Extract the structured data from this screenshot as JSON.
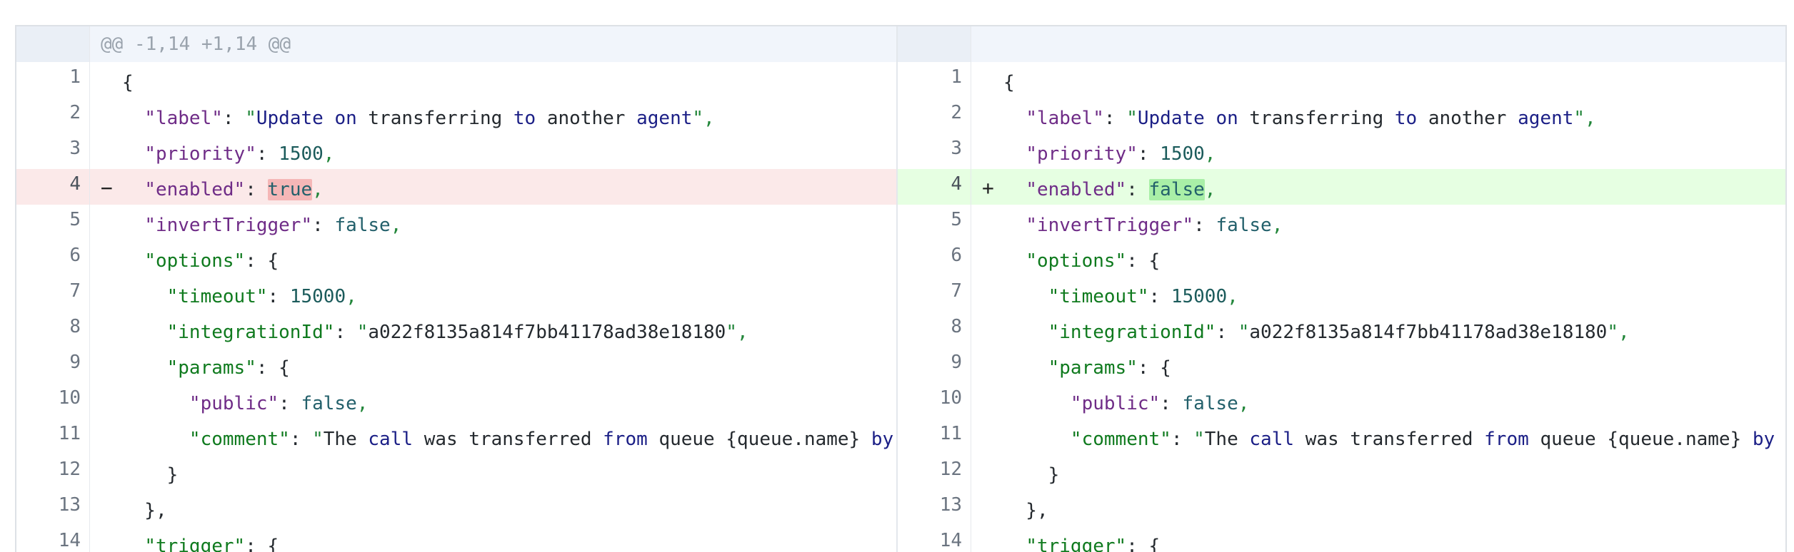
{
  "hunk_header": "@@ -1,14 +1,14 @@",
  "markers": {
    "removed": "−",
    "added": "+"
  },
  "left": {
    "lines": [
      {
        "n": "1",
        "t": "{"
      },
      {
        "n": "2",
        "pre": "  ",
        "k": "\"label\"",
        "sep": ": ",
        "v": "\"Update on transferring to another agent\"",
        "post": ","
      },
      {
        "n": "3",
        "pre": "  ",
        "k": "\"priority\"",
        "sep": ": ",
        "v": "1500",
        "post": ","
      },
      {
        "n": "4",
        "pre": "  ",
        "k": "\"enabled\"",
        "sep": ": ",
        "v": "true",
        "post": ",",
        "type": "del"
      },
      {
        "n": "5",
        "pre": "  ",
        "k": "\"invertTrigger\"",
        "sep": ": ",
        "v": "false",
        "post": ","
      },
      {
        "n": "6",
        "pre": "  ",
        "k": "\"options\"",
        "sep": ": ",
        "v": "{",
        "post": ""
      },
      {
        "n": "7",
        "pre": "    ",
        "k": "\"timeout\"",
        "sep": ": ",
        "v": "15000",
        "post": ","
      },
      {
        "n": "8",
        "pre": "    ",
        "k": "\"integrationId\"",
        "sep": ": ",
        "v": "\"a022f8135a814f7bb41178ad38e18180\"",
        "post": ","
      },
      {
        "n": "9",
        "pre": "    ",
        "k": "\"params\"",
        "sep": ": ",
        "v": "{",
        "post": ""
      },
      {
        "n": "10",
        "pre": "      ",
        "k": "\"public\"",
        "sep": ": ",
        "v": "false",
        "post": ","
      },
      {
        "n": "11",
        "pre": "      ",
        "k": "\"comment\"",
        "sep": ": ",
        "v": "\"The call was transferred from queue {queue.name} by agent {ag",
        "post": ""
      },
      {
        "n": "12",
        "t": "    }"
      },
      {
        "n": "13",
        "t": "  },"
      },
      {
        "n": "14",
        "pre": "  ",
        "k": "\"trigger\"",
        "sep": ": ",
        "v": "{",
        "post": ""
      }
    ]
  },
  "right": {
    "lines": [
      {
        "n": "1",
        "t": "{"
      },
      {
        "n": "2",
        "pre": "  ",
        "k": "\"label\"",
        "sep": ": ",
        "v": "\"Update on transferring to another agent\"",
        "post": ","
      },
      {
        "n": "3",
        "pre": "  ",
        "k": "\"priority\"",
        "sep": ": ",
        "v": "1500",
        "post": ","
      },
      {
        "n": "4",
        "pre": "  ",
        "k": "\"enabled\"",
        "sep": ": ",
        "v": "false",
        "post": ",",
        "type": "add"
      },
      {
        "n": "5",
        "pre": "  ",
        "k": "\"invertTrigger\"",
        "sep": ": ",
        "v": "false",
        "post": ","
      },
      {
        "n": "6",
        "pre": "  ",
        "k": "\"options\"",
        "sep": ": ",
        "v": "{",
        "post": ""
      },
      {
        "n": "7",
        "pre": "    ",
        "k": "\"timeout\"",
        "sep": ": ",
        "v": "15000",
        "post": ","
      },
      {
        "n": "8",
        "pre": "    ",
        "k": "\"integrationId\"",
        "sep": ": ",
        "v": "\"a022f8135a814f7bb41178ad38e18180\"",
        "post": ","
      },
      {
        "n": "9",
        "pre": "    ",
        "k": "\"params\"",
        "sep": ": ",
        "v": "{",
        "post": ""
      },
      {
        "n": "10",
        "pre": "      ",
        "k": "\"public\"",
        "sep": ": ",
        "v": "false",
        "post": ","
      },
      {
        "n": "11",
        "pre": "      ",
        "k": "\"comment\"",
        "sep": ": ",
        "v": "\"The call was transferred from queue {queue.name} by agent {age",
        "post": ""
      },
      {
        "n": "12",
        "t": "    }"
      },
      {
        "n": "13",
        "t": "  },"
      },
      {
        "n": "14",
        "pre": "  ",
        "k": "\"trigger\"",
        "sep": ": ",
        "v": "{",
        "post": ""
      }
    ]
  },
  "colors": {
    "deleted_line_bg": "#fbe9e9",
    "added_line_bg": "#e6ffe2",
    "deleted_word_bg": "#f5b7b7",
    "added_word_bg": "#a9efa7",
    "hunk_header_bg": "#f1f5fb"
  }
}
